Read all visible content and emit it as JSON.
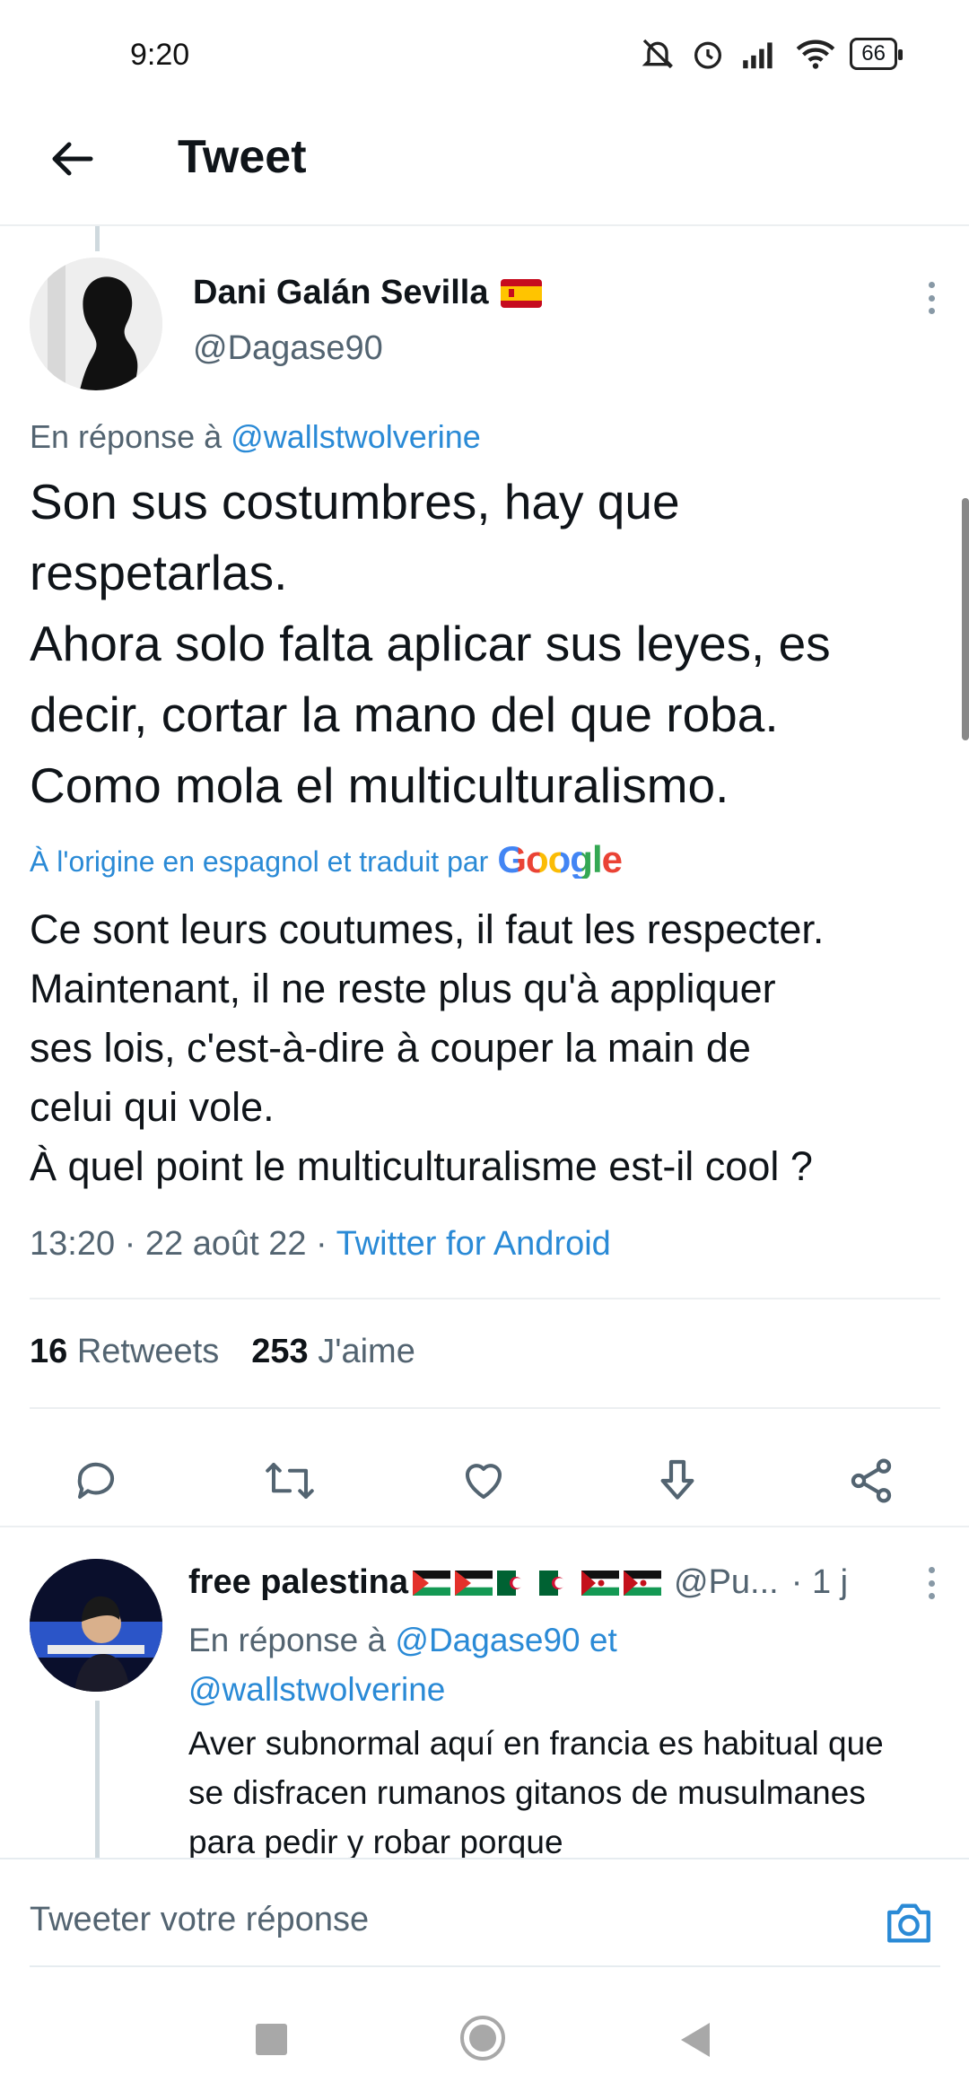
{
  "status_bar": {
    "time": "9:20",
    "battery": "66"
  },
  "header": {
    "title": "Tweet"
  },
  "tweet": {
    "author_name": "Dani Galán Sevilla",
    "author_handle": "@Dagase90",
    "reply_to_prefix": "En réponse à",
    "reply_to_handle": "@wallstwolverine",
    "text": "Son sus costumbres, hay que\nrespetarlas.\nAhora solo falta aplicar sus leyes, es\ndecir, cortar la mano del que roba.\nComo mola el multiculturalismo.",
    "translation_note": "À l'origine en espagnol et traduit par",
    "translation_provider": "Google",
    "translation": "Ce sont leurs coutumes, il faut les respecter.\nMaintenant, il ne reste plus qu'à appliquer\nses lois, c'est-à-dire à couper la main de\ncelui qui vole.\nÀ quel point le multiculturalisme est-il cool ?",
    "time": "13:20 · 22 août 22 · ",
    "source": "Twitter for Android",
    "retweets_count": "16",
    "retweets_label": "Retweets",
    "likes_count": "253",
    "likes_label": "J'aime"
  },
  "reply": {
    "author_name": "free palestina",
    "author_handle": "@Pu...",
    "age": "· 1 j",
    "reply_to_prefix": "En réponse à",
    "reply_to_handle_1": "@Dagase90",
    "reply_to_conj": "et",
    "reply_to_handle_2": "@wallstwolverine",
    "text": "Aver subnormal aquí en francia es habitual que se disfracen rumanos gitanos de musulmanes para pedir y robar porque"
  },
  "compose": {
    "placeholder": "Tweeter votre réponse"
  },
  "colors": {
    "link": "#2a8ad6",
    "secondary_text": "#536471",
    "accent": "#1d9bf0"
  },
  "icons": [
    "back-arrow-icon",
    "more-vertical-icon",
    "reply-icon",
    "retweet-icon",
    "like-icon",
    "share-download-icon",
    "share-icon",
    "camera-icon",
    "spain-flag-icon",
    "palestine-flag-icon",
    "western-sahara-flag-icon",
    "algeria-flag-icon"
  ]
}
